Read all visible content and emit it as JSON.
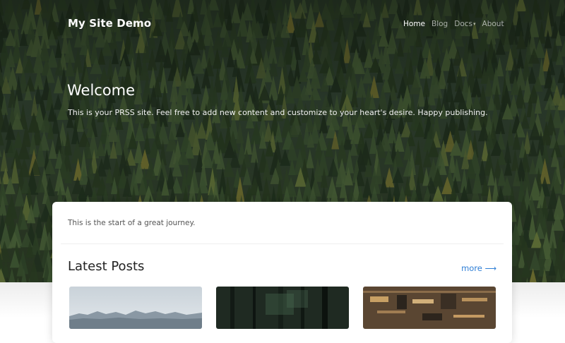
{
  "navbar": {
    "brand": "My Site Demo",
    "links": [
      {
        "label": "Home",
        "active": true
      },
      {
        "label": "Blog",
        "active": false
      },
      {
        "label": "Docs",
        "active": false,
        "caret": "▾"
      },
      {
        "label": "About",
        "active": false
      }
    ]
  },
  "hero": {
    "title": "Welcome",
    "subtitle": "This is your PRSS site. Feel free to add new content and customize to your heart's desire. Happy publishing."
  },
  "main": {
    "intro": "This is the start of a great journey.",
    "latest_posts": {
      "title": "Latest Posts",
      "more_label": "more ⟶",
      "posts": [
        {
          "image": "mountains-photo"
        },
        {
          "image": "forest-photo"
        },
        {
          "image": "circuit-board-photo"
        }
      ]
    }
  },
  "colors": {
    "link": "#2f7fd6",
    "forest": "#2f4030"
  }
}
